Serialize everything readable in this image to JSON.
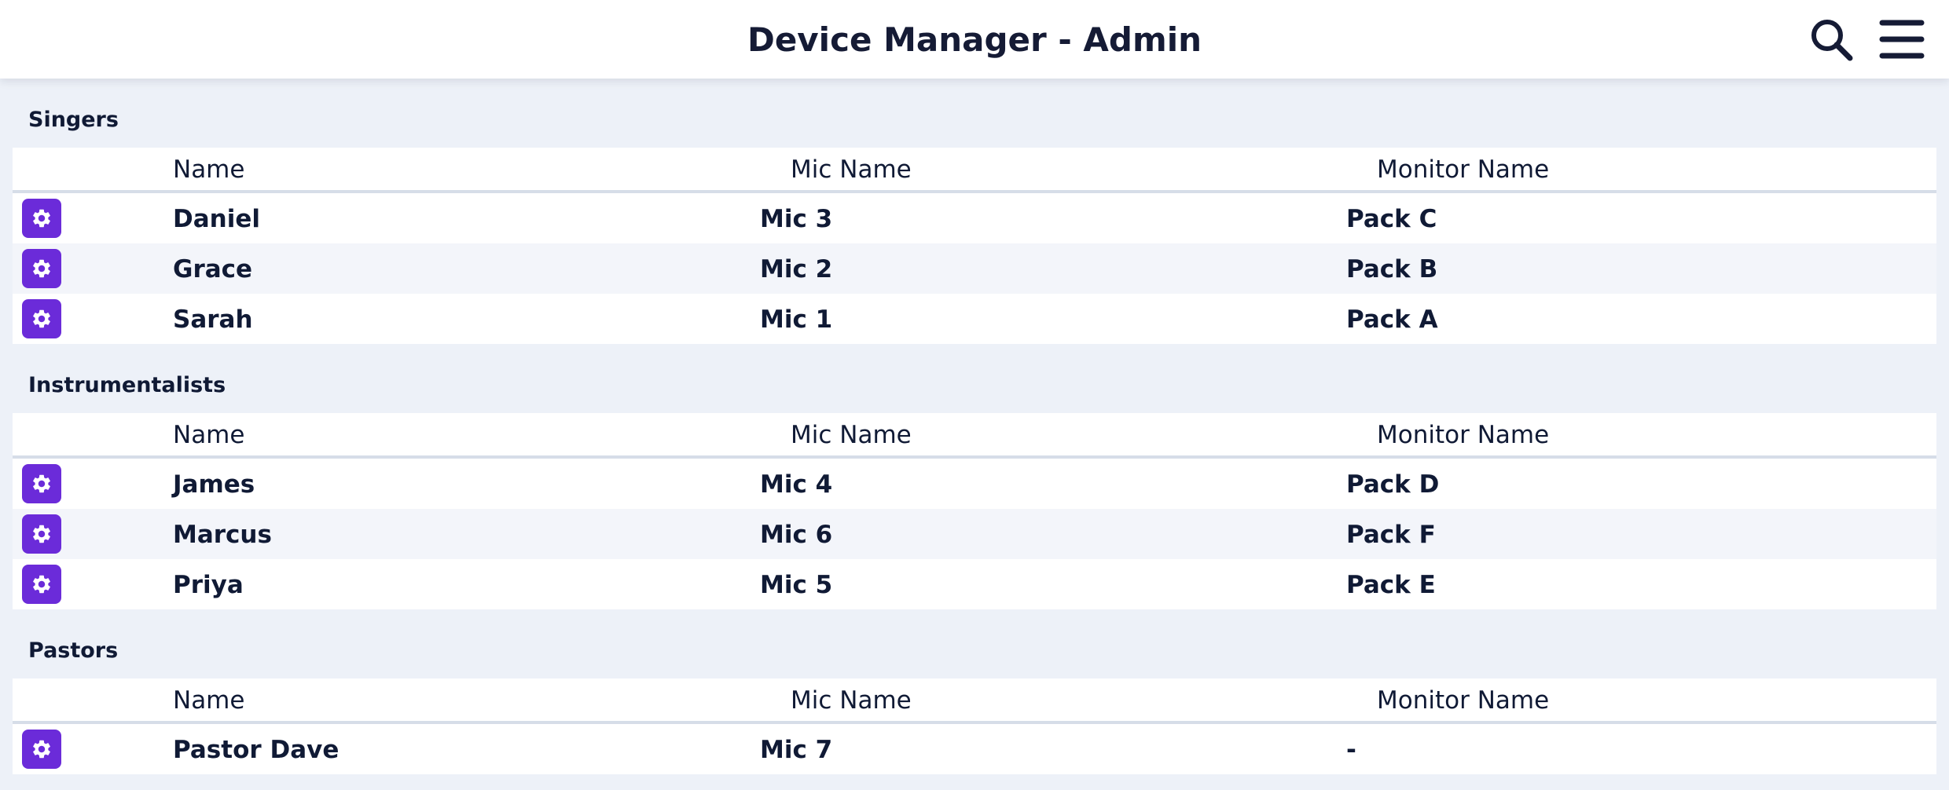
{
  "header": {
    "title": "Device Manager - Admin",
    "search_icon": "search-icon",
    "menu_icon": "hamburger-menu-icon"
  },
  "colors": {
    "accent": "#6b2bd9",
    "background": "#edf1f8",
    "text": "#101a35"
  },
  "columns": {
    "name": "Name",
    "mic": "Mic Name",
    "monitor": "Monitor Name"
  },
  "row_action_icon": "gear-icon",
  "sections": [
    {
      "title": "Singers",
      "rows": [
        {
          "name": "Daniel",
          "mic": "Mic 3",
          "monitor": "Pack C"
        },
        {
          "name": "Grace",
          "mic": "Mic 2",
          "monitor": "Pack B"
        },
        {
          "name": "Sarah",
          "mic": "Mic 1",
          "monitor": "Pack A"
        }
      ]
    },
    {
      "title": "Instrumentalists",
      "rows": [
        {
          "name": "James",
          "mic": "Mic 4",
          "monitor": "Pack D"
        },
        {
          "name": "Marcus",
          "mic": "Mic 6",
          "monitor": "Pack F"
        },
        {
          "name": "Priya",
          "mic": "Mic 5",
          "monitor": "Pack E"
        }
      ]
    },
    {
      "title": "Pastors",
      "rows": [
        {
          "name": "Pastor Dave",
          "mic": "Mic 7",
          "monitor": "-"
        }
      ]
    }
  ]
}
